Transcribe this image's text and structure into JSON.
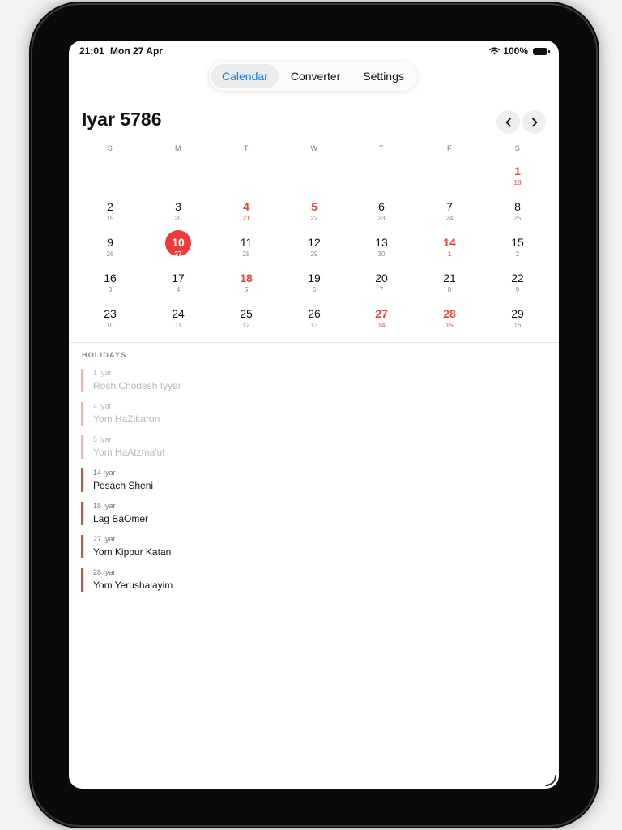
{
  "status_bar": {
    "time": "21:01",
    "date": "Mon 27 Apr",
    "battery": "100%"
  },
  "tabs": [
    {
      "label": "Calendar",
      "active": true
    },
    {
      "label": "Converter",
      "active": false
    },
    {
      "label": "Settings",
      "active": false
    }
  ],
  "calendar": {
    "month_title": "Iyar 5786",
    "weekdays": [
      "S",
      "M",
      "T",
      "W",
      "T",
      "F",
      "S"
    ],
    "weeks": [
      [
        null,
        null,
        null,
        null,
        null,
        null,
        {
          "g": "1",
          "h": "18",
          "holiday": true
        }
      ],
      [
        {
          "g": "2",
          "h": "19"
        },
        {
          "g": "3",
          "h": "20"
        },
        {
          "g": "4",
          "h": "21",
          "holiday": true
        },
        {
          "g": "5",
          "h": "22",
          "holiday": true
        },
        {
          "g": "6",
          "h": "23"
        },
        {
          "g": "7",
          "h": "24"
        },
        {
          "g": "8",
          "h": "25"
        }
      ],
      [
        {
          "g": "9",
          "h": "26"
        },
        {
          "g": "10",
          "h": "27",
          "today": true
        },
        {
          "g": "11",
          "h": "28"
        },
        {
          "g": "12",
          "h": "29"
        },
        {
          "g": "13",
          "h": "30"
        },
        {
          "g": "14",
          "h": "1",
          "holiday": true
        },
        {
          "g": "15",
          "h": "2"
        }
      ],
      [
        {
          "g": "16",
          "h": "3"
        },
        {
          "g": "17",
          "h": "4"
        },
        {
          "g": "18",
          "h": "5",
          "holiday": true
        },
        {
          "g": "19",
          "h": "6"
        },
        {
          "g": "20",
          "h": "7"
        },
        {
          "g": "21",
          "h": "8"
        },
        {
          "g": "22",
          "h": "9"
        }
      ],
      [
        {
          "g": "23",
          "h": "10"
        },
        {
          "g": "24",
          "h": "11"
        },
        {
          "g": "25",
          "h": "12"
        },
        {
          "g": "26",
          "h": "13"
        },
        {
          "g": "27",
          "h": "14",
          "holiday": true
        },
        {
          "g": "28",
          "h": "15",
          "holiday": true
        },
        {
          "g": "29",
          "h": "16"
        }
      ]
    ]
  },
  "holidays": {
    "title": "HOLIDAYS",
    "items": [
      {
        "date": "1 Iyar",
        "name": "Rosh Chodesh Iyyar",
        "past": true
      },
      {
        "date": "4 Iyar",
        "name": "Yom HaZikaron",
        "past": true
      },
      {
        "date": "5 Iyar",
        "name": "Yom HaAtzma'ut",
        "past": true
      },
      {
        "date": "14 Iyar",
        "name": "Pesach Sheni",
        "past": false
      },
      {
        "date": "18 Iyar",
        "name": "Lag BaOmer",
        "past": false
      },
      {
        "date": "27 Iyar",
        "name": "Yom Kippur Katan",
        "past": false
      },
      {
        "date": "28 Iyar",
        "name": "Yom Yerushalayim",
        "past": false
      }
    ]
  },
  "colors": {
    "accent_blue": "#1b7fd8",
    "holiday_red": "#e8453c",
    "today_red": "#f03a3a"
  }
}
